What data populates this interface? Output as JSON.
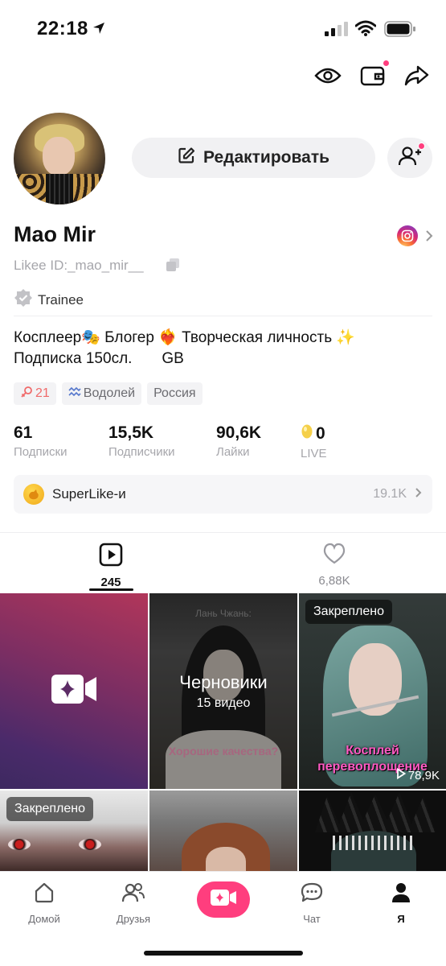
{
  "status_bar": {
    "time": "22:18"
  },
  "profile": {
    "name": "Mao Mir",
    "likee_id": "Likee ID:_mao_mir__",
    "level": "Trainee",
    "edit_button": "Редактировать",
    "bio_line1": "Косплеер🎭 Блогер ❤️‍🔥 Творческая личность ✨",
    "bio_line2": "Подписка 150сл.       GB",
    "tags": [
      {
        "label": "21",
        "icon": "female-icon"
      },
      {
        "label": "Водолей",
        "icon": "aquarius-icon"
      },
      {
        "label": "Россия"
      }
    ]
  },
  "stats": [
    {
      "value": "61",
      "label": "Подписки"
    },
    {
      "value": "15,5K",
      "label": "Подписчики"
    },
    {
      "value": "90,6K",
      "label": "Лайки"
    },
    {
      "value": "0",
      "label": "LIVE",
      "icon": "bean-icon"
    }
  ],
  "superlike": {
    "label": "SuperLike-и",
    "count": "19.1K"
  },
  "tabs": [
    {
      "icon": "video-play-icon",
      "count": "245",
      "active": true
    },
    {
      "icon": "heart-icon",
      "count": "6,88K",
      "active": false
    }
  ],
  "grid": {
    "drafts": {
      "title": "Черновики",
      "subtitle": "15 видео",
      "faint_top": "Лань Чжань:",
      "faint_bottom": "Хорошие качества?"
    },
    "pinned_label": "Закреплено",
    "pinned_caption": "Косплей перевоплощение",
    "pinned_views": "78,9K"
  },
  "bottom_nav": [
    {
      "label": "Домой",
      "icon": "home-icon"
    },
    {
      "label": "Друзья",
      "icon": "friends-icon"
    },
    {
      "label": "",
      "icon": "create-video-icon"
    },
    {
      "label": "Чат",
      "icon": "chat-icon"
    },
    {
      "label": "Я",
      "icon": "profile-icon",
      "active": true
    }
  ],
  "colors": {
    "accent": "#ff3e7e",
    "muted": "#a6a6ab",
    "pinned_caption": "#ff59c2"
  }
}
